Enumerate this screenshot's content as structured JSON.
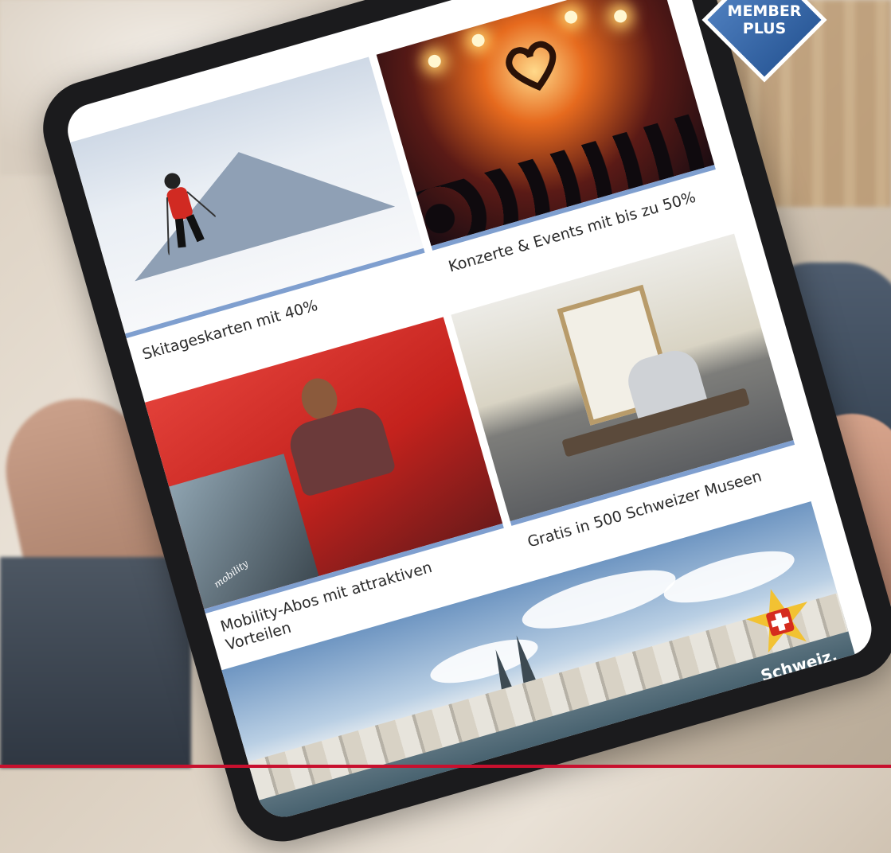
{
  "badge": {
    "line1": "MEMBER",
    "line2": "PLUS",
    "color": "#2a5a9a"
  },
  "tiles": {
    "ski": {
      "caption": "Skitageskarten mit 40%"
    },
    "concert": {
      "caption": "Konzerte & Events mit bis zu 50%"
    },
    "mobility": {
      "caption_line1": "Mobility-Abos mit attraktiven",
      "caption_line2": "Vorteilen",
      "car_text": "mobility"
    },
    "museum": {
      "caption": "Gratis in 500 Schweizer Museen"
    },
    "lucerne": {
      "logo_text": "Schweiz."
    }
  },
  "colors": {
    "accent_bar": "#7f9fcf",
    "bottom_line": "#c8102e"
  }
}
